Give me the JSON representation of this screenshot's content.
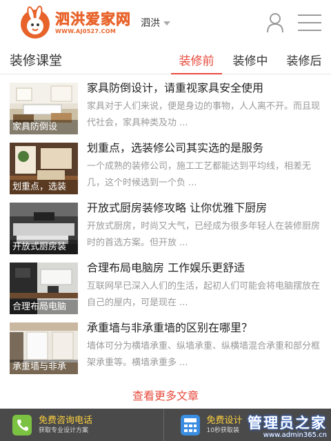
{
  "header": {
    "logo_title": "泗洪爱家网",
    "logo_url": "WWW.AJ0527.COM",
    "city": "泗洪"
  },
  "section": {
    "title": "装修课堂",
    "tabs": [
      {
        "label": "装修前",
        "active": true
      },
      {
        "label": "装修中",
        "active": false
      },
      {
        "label": "装修后",
        "active": false
      }
    ]
  },
  "articles": [
    {
      "thumb_caption": "家具防倒设",
      "title": "家具防倒设计，请重视家具安全使用",
      "desc": "家具对于人们来说，便是身边的事物，人人离不开。而且现代社会，家具种类及功 ..."
    },
    {
      "thumb_caption": "划重点，选装",
      "title": "划重点，选装修公司其实选的是服务",
      "desc": "一个成熟的装修公司，施工工艺都能达到平均线，相差无几，这个时候选到一个负 ..."
    },
    {
      "thumb_caption": "开放式厨房装",
      "title": "开放式厨房装修攻略 让你优雅下厨房",
      "desc": "开放式厨房，时尚又大气，已经成为很多年轻人在装修厨房时的首选方案。但开放 ..."
    },
    {
      "thumb_caption": "合理布局电脑",
      "title": "合理布局电脑房 工作娱乐更舒适",
      "desc": "互联网早已深入人们的生活，起初人们可能会将电脑摆放在自己的屋内，可是现在 ..."
    },
    {
      "thumb_caption": "承重墙与非承",
      "title": "承重墙与非承重墙的区别在哪里？",
      "desc": "墙体可分为横墙承重、纵墙承重、纵横墙混合承重和部分框架承重等。横墙承重多 ..."
    }
  ],
  "more_label": "查看更多文章",
  "footer": {
    "call_main": "免费咨询电话",
    "call_sub": "获取专业设计方案",
    "design_main": "免费设计",
    "design_sub": "10秒获取装"
  },
  "watermark": {
    "main": "管理员之家",
    "url": "www.admin365.cn"
  },
  "colors": {
    "accent": "#e74a3b",
    "logo": "#e8632a",
    "footer_bg": "#4a4a4a",
    "footer_highlight": "#ffd23f"
  }
}
